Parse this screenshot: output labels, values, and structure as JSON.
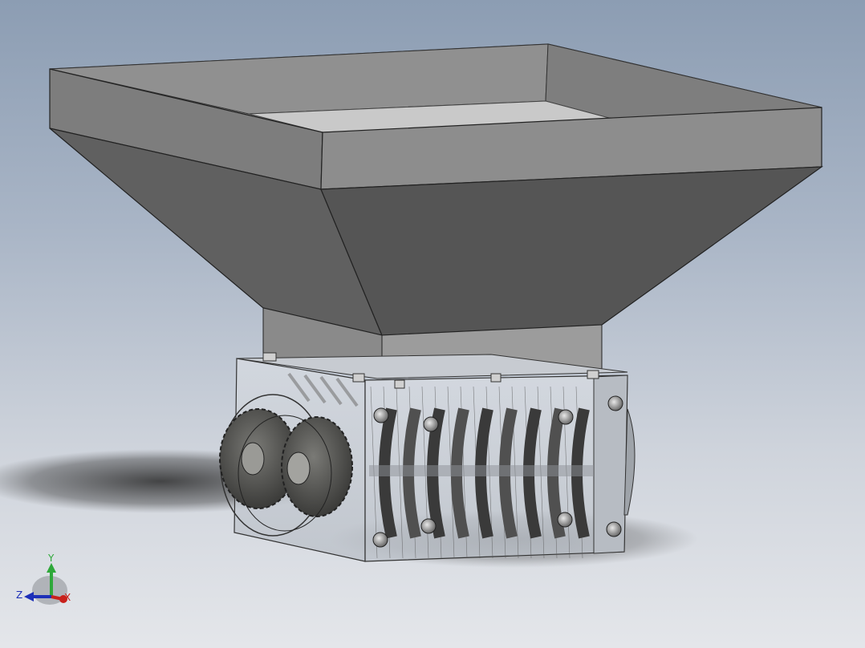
{
  "viewport": {
    "view": "isometric",
    "model": "hopper-shredder-assembly",
    "colors": {
      "background_top": "#8c9db3",
      "background_bottom": "#e4e6ea",
      "hopper_light": "#8f8f8f",
      "hopper_dark": "#5c5c5c",
      "housing": "#c8ccd2",
      "gear": "#4a4a48"
    }
  },
  "triad": {
    "y_label": "Y",
    "z_label": "Z",
    "x_label": "X",
    "colors": {
      "y": "#2fa83a",
      "z": "#1d2fb8",
      "x": "#c8201b"
    }
  }
}
